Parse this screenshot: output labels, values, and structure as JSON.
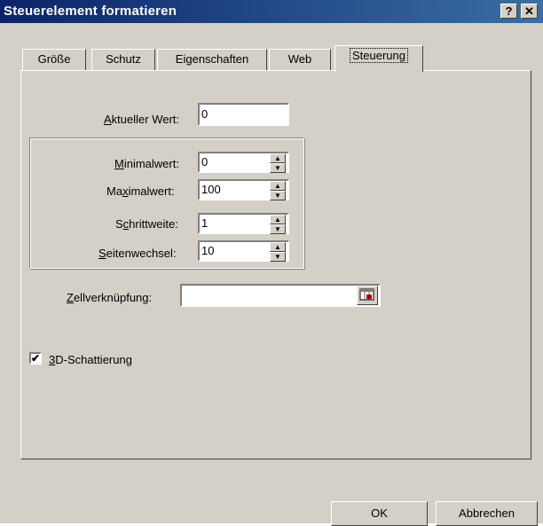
{
  "window": {
    "title": "Steuerelement formatieren",
    "help_label": "?",
    "close_label": "✕"
  },
  "tabs": [
    {
      "label": "Größe"
    },
    {
      "label": "Schutz"
    },
    {
      "label": "Eigenschaften"
    },
    {
      "label": "Web"
    },
    {
      "label": "Steuerung",
      "active": true
    }
  ],
  "fields": {
    "aktueller_wert": {
      "label_pre": "",
      "label_ul": "A",
      "label_post": "ktueller Wert:",
      "value": "0"
    },
    "minimalwert": {
      "label_pre": "",
      "label_ul": "M",
      "label_post": "inimalwert:",
      "value": "0"
    },
    "maximalwert": {
      "label_pre": "Ma",
      "label_ul": "x",
      "label_post": "imalwert:",
      "value": "100"
    },
    "schrittweite": {
      "label_pre": "S",
      "label_ul": "c",
      "label_post": "hrittweite:",
      "value": "1"
    },
    "seitenwechsel": {
      "label_pre": "",
      "label_ul": "S",
      "label_post": "eitenwechsel:",
      "value": "10"
    },
    "zellverknuepfung": {
      "label_pre": "",
      "label_ul": "Z",
      "label_post": "ellverknüpfung:",
      "value": ""
    }
  },
  "checkbox_3d": {
    "label_pre": "",
    "label_ul": "3",
    "label_post": "D-Schattierung",
    "checked": true,
    "mark": "✔"
  },
  "buttons": {
    "ok": "OK",
    "cancel": "Abbrechen"
  },
  "spin_arrows": {
    "up": "▲",
    "down": "▼"
  }
}
